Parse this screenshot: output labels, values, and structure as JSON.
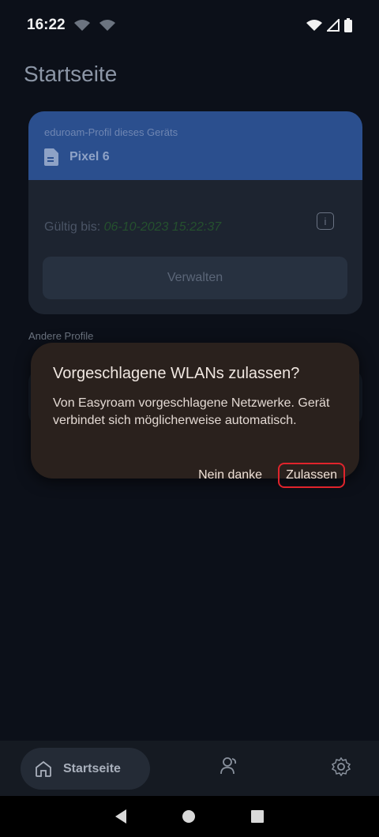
{
  "status": {
    "time": "16:22"
  },
  "header": {
    "title": "Startseite"
  },
  "profile": {
    "subtitle": "eduroam-Profil dieses Geräts",
    "device": "Pixel 6",
    "valid_label": "Gültig bis:",
    "valid_date": "06-10-2023 15:22:37",
    "manage_label": "Verwalten"
  },
  "other_profiles_label": "Andere Profile",
  "dialog": {
    "title": "Vorgeschlagene WLANs zulassen?",
    "body": "Von Easyroam vorgeschlagene Netzwerke. Gerät verbindet sich möglicherweise automatisch.",
    "deny_label": "Nein danke",
    "allow_label": "Zulassen"
  },
  "bottom_nav": {
    "home_label": "Startseite"
  },
  "colors": {
    "card_header": "#2b4f8e",
    "dialog_bg": "#2a211d",
    "highlight": "#e0242c"
  }
}
